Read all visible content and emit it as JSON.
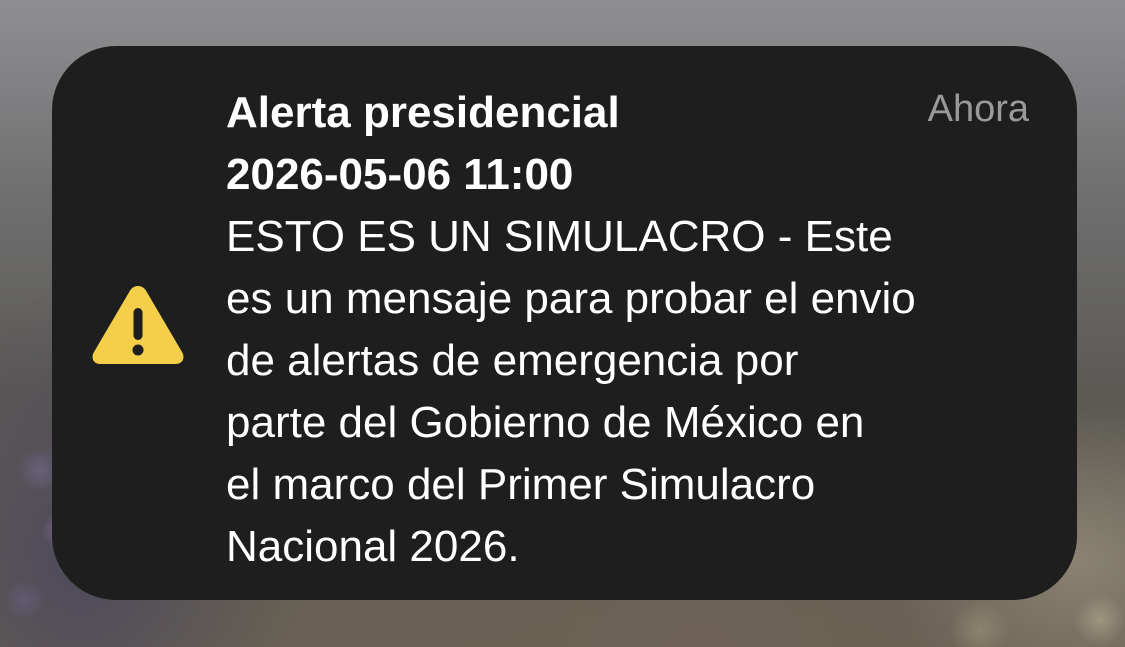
{
  "notification": {
    "title_line1": "Alerta presidencial",
    "title_line2": "2026-05-06 11:00",
    "time": "Ahora",
    "icon": "warning-triangle-icon",
    "body_lines": [
      "ESTO ES UN SIMULACRO - Este",
      "es un mensaje para probar el envio",
      "de alertas de emergencia por",
      "parte del Gobierno de México en",
      "el marco del Primer Simulacro",
      "Nacional 2026."
    ]
  },
  "colors": {
    "card_background": "#1e1e1e",
    "warning_yellow": "#f5cf4a",
    "text_primary": "#ffffff",
    "text_secondary": "#9a9a9a"
  }
}
